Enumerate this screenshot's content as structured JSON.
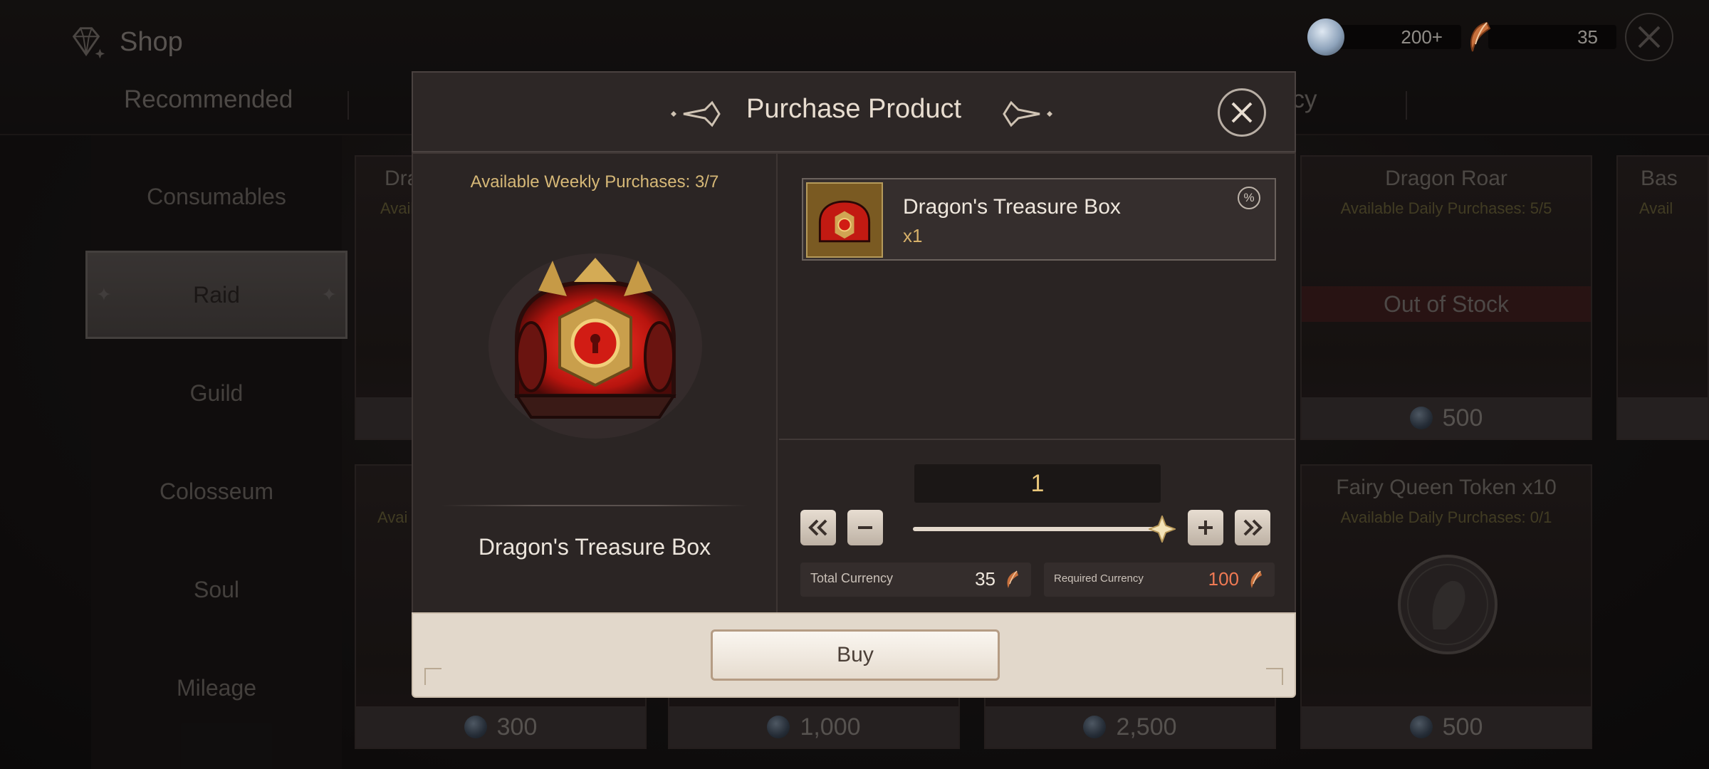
{
  "shop": {
    "title": "Shop",
    "icon": "gem-icon",
    "currencies": [
      {
        "icon": "crystal-currency-icon",
        "amount": "200+"
      },
      {
        "icon": "fang-currency-icon",
        "amount": "35"
      }
    ],
    "tabs": [
      {
        "label": "Recommended"
      },
      {
        "label": "ncy"
      }
    ],
    "sidebar": [
      {
        "label": "Consumables",
        "active": false
      },
      {
        "label": "Raid",
        "active": true
      },
      {
        "label": "Guild",
        "active": false
      },
      {
        "label": "Colosseum",
        "active": false
      },
      {
        "label": "Soul",
        "active": false
      },
      {
        "label": "Mileage",
        "active": false
      }
    ],
    "cards": [
      {
        "title": "Dra",
        "subtitle": "Availa",
        "price": ""
      },
      {
        "title": "Dragon Roar",
        "subtitle": "Available Daily Purchases: 5/5",
        "status": "Out of Stock",
        "price": "500"
      },
      {
        "title": "Bas",
        "subtitle": "Avail",
        "price": ""
      },
      {
        "title": "",
        "subtitle": "Avai",
        "price": "300"
      },
      {
        "title": "",
        "subtitle": "",
        "price": "1,000"
      },
      {
        "title": "",
        "subtitle": "",
        "price": "2,500"
      },
      {
        "title": "Fairy Queen Token x10",
        "subtitle": "Available Daily Purchases: 0/1",
        "price": "500"
      }
    ]
  },
  "modal": {
    "title": "Purchase Product",
    "weekly": "Available Weekly Purchases: 3/7",
    "item_name": "Dragon's Treasure Box",
    "product": {
      "name": "Dragon's Treasure Box",
      "qty": "x1",
      "badge": "%"
    },
    "quantity": "1",
    "slider_fraction": 1.0,
    "total_currency": {
      "label": "Total Currency",
      "value": "35"
    },
    "required_currency": {
      "label": "Required Currency",
      "value": "100"
    },
    "buy_label": "Buy",
    "colors": {
      "accent_gold": "#d6b877",
      "required_red": "#f07a54"
    }
  }
}
